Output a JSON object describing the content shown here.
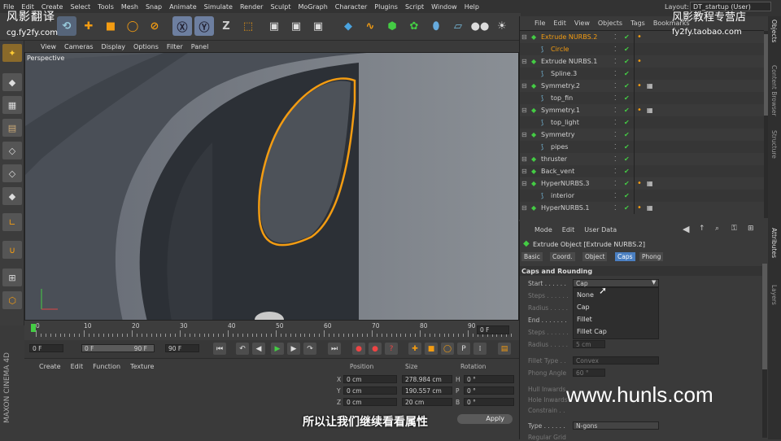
{
  "watermarks": {
    "top_left_cn": "风影翻译",
    "top_left_url": "cg.fy2fy.com",
    "top_right_cn": "风影教程专营店",
    "top_right_url": "fy2fy.taobao.com",
    "bottom_right": "www.hunls.com",
    "subtitle": "所以让我们继续看看属性"
  },
  "menubar": [
    "File",
    "Edit",
    "Create",
    "Select",
    "Tools",
    "Mesh",
    "Snap",
    "Animate",
    "Simulate",
    "Render",
    "Sculpt",
    "MoGraph",
    "Character",
    "Plugins",
    "Script",
    "Window",
    "Help"
  ],
  "layout": {
    "label": "Layout:",
    "value": "DT_startup (User)"
  },
  "viewport": {
    "menu": [
      "View",
      "Cameras",
      "Display",
      "Options",
      "Filter",
      "Panel"
    ],
    "label": "Perspective"
  },
  "timeline": {
    "ticks": [
      "0",
      "10",
      "20",
      "30",
      "40",
      "50",
      "60",
      "70",
      "80",
      "90"
    ],
    "current": "0 F"
  },
  "playbar": {
    "start": "0 F",
    "range_start": "0 F",
    "range_end": "90 F",
    "end": "90 F"
  },
  "material_manager": {
    "menu": [
      "Create",
      "Edit",
      "Function",
      "Texture"
    ]
  },
  "coordinates": {
    "headers": [
      "Position",
      "Size",
      "Rotation"
    ],
    "rows": [
      {
        "axis": "X",
        "pos": "0 cm",
        "size": "278.984 cm",
        "rot_axis": "H",
        "rot": "0 °"
      },
      {
        "axis": "Y",
        "pos": "0 cm",
        "size": "190.557 cm",
        "rot_axis": "P",
        "rot": "0 °"
      },
      {
        "axis": "Z",
        "pos": "0 cm",
        "size": "20 cm",
        "rot_axis": "B",
        "rot": "0 °"
      }
    ],
    "apply": "Apply"
  },
  "object_manager": {
    "menu": [
      "File",
      "Edit",
      "View",
      "Objects",
      "Tags",
      "Bookmarks"
    ],
    "objects": [
      {
        "name": "Extrude NURBS.2",
        "indent": 0,
        "selected": true,
        "color": "#f39c12"
      },
      {
        "name": "Circle",
        "indent": 1,
        "selected": true,
        "color": "#f39c12"
      },
      {
        "name": "Extrude NURBS.1",
        "indent": 0,
        "selected": false,
        "color": "#cfcfcf"
      },
      {
        "name": "Spline.3",
        "indent": 1,
        "selected": false,
        "color": "#cfcfcf"
      },
      {
        "name": "Symmetry.2",
        "indent": 0,
        "selected": false,
        "color": "#cfcfcf"
      },
      {
        "name": "top_fin",
        "indent": 1,
        "selected": false,
        "color": "#cfcfcf"
      },
      {
        "name": "Symmetry.1",
        "indent": 0,
        "selected": false,
        "color": "#cfcfcf"
      },
      {
        "name": "top_light",
        "indent": 1,
        "selected": false,
        "color": "#cfcfcf"
      },
      {
        "name": "Symmetry",
        "indent": 0,
        "selected": false,
        "color": "#cfcfcf"
      },
      {
        "name": "pipes",
        "indent": 1,
        "selected": false,
        "color": "#cfcfcf"
      },
      {
        "name": "thruster",
        "indent": 0,
        "selected": false,
        "color": "#cfcfcf"
      },
      {
        "name": "Back_vent",
        "indent": 0,
        "selected": false,
        "color": "#cfcfcf"
      },
      {
        "name": "HyperNURBS.3",
        "indent": 0,
        "selected": false,
        "color": "#cfcfcf"
      },
      {
        "name": "interior",
        "indent": 1,
        "selected": false,
        "color": "#cfcfcf"
      },
      {
        "name": "HyperNURBS.1",
        "indent": 0,
        "selected": false,
        "color": "#cfcfcf"
      }
    ]
  },
  "attributes": {
    "menu": [
      "Mode",
      "Edit",
      "User Data"
    ],
    "title": "Extrude Object [Extrude NURBS.2]",
    "tabs": [
      "Basic",
      "Coord.",
      "Object",
      "Caps",
      "Phong"
    ],
    "active_tab": "Caps",
    "section": "Caps and Rounding",
    "fields": {
      "start": {
        "label": "Start . . . . . .",
        "value": "Cap"
      },
      "steps": {
        "label": "Steps . . . . . ."
      },
      "radius": {
        "label": "Radius . . . . ."
      },
      "end": {
        "label": "End . . . . . . ."
      },
      "steps2": {
        "label": "Steps . . . . . ."
      },
      "radius2": {
        "label": "Radius . . . . .",
        "value": "5 cm"
      },
      "fillet_type": {
        "label": "Fillet Type . .",
        "value": "Convex"
      },
      "phong_angle": {
        "label": "Phong Angle",
        "value": "60 °"
      },
      "hull_inwards": {
        "label": "Hull Inwards"
      },
      "hole_inwards": {
        "label": "Hole Inwards"
      },
      "constrain": {
        "label": "Constrain . ."
      },
      "type": {
        "label": "Type . . . . . .",
        "value": "N-gons"
      },
      "regular_grid": {
        "label": "Regular Grid"
      }
    },
    "dropdown_options": [
      "None",
      "Cap",
      "Fillet",
      "Fillet Cap"
    ]
  },
  "sidetabs": [
    "Objects",
    "Content Browser",
    "Structure",
    "Attributes",
    "Layers"
  ],
  "colors": {
    "accent": "#f39c12",
    "selection_blue": "#4a7fc1",
    "panel": "#3a3a3a"
  }
}
